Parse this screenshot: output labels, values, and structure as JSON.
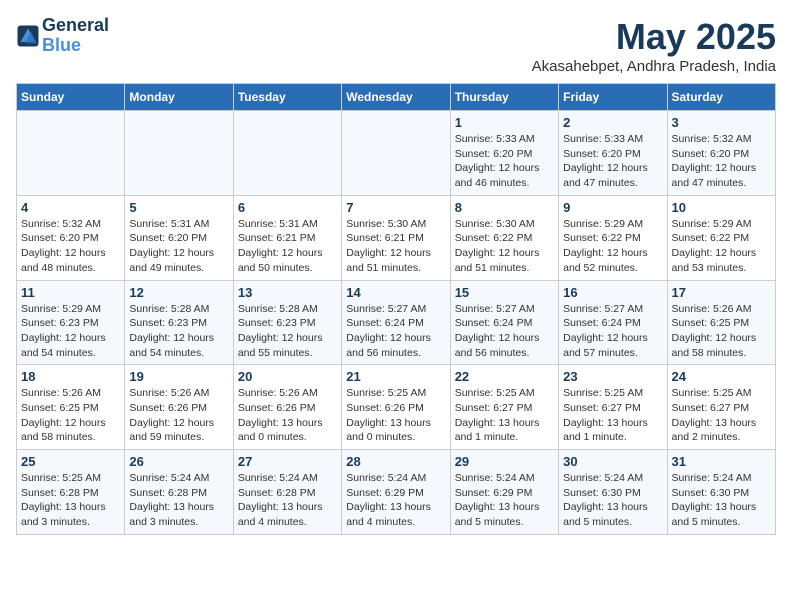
{
  "logo": {
    "line1": "General",
    "line2": "Blue"
  },
  "title": "May 2025",
  "location": "Akasahebpet, Andhra Pradesh, India",
  "days_of_week": [
    "Sunday",
    "Monday",
    "Tuesday",
    "Wednesday",
    "Thursday",
    "Friday",
    "Saturday"
  ],
  "weeks": [
    [
      {
        "day": "",
        "info": ""
      },
      {
        "day": "",
        "info": ""
      },
      {
        "day": "",
        "info": ""
      },
      {
        "day": "",
        "info": ""
      },
      {
        "day": "1",
        "info": "Sunrise: 5:33 AM\nSunset: 6:20 PM\nDaylight: 12 hours\nand 46 minutes."
      },
      {
        "day": "2",
        "info": "Sunrise: 5:33 AM\nSunset: 6:20 PM\nDaylight: 12 hours\nand 47 minutes."
      },
      {
        "day": "3",
        "info": "Sunrise: 5:32 AM\nSunset: 6:20 PM\nDaylight: 12 hours\nand 47 minutes."
      }
    ],
    [
      {
        "day": "4",
        "info": "Sunrise: 5:32 AM\nSunset: 6:20 PM\nDaylight: 12 hours\nand 48 minutes."
      },
      {
        "day": "5",
        "info": "Sunrise: 5:31 AM\nSunset: 6:20 PM\nDaylight: 12 hours\nand 49 minutes."
      },
      {
        "day": "6",
        "info": "Sunrise: 5:31 AM\nSunset: 6:21 PM\nDaylight: 12 hours\nand 50 minutes."
      },
      {
        "day": "7",
        "info": "Sunrise: 5:30 AM\nSunset: 6:21 PM\nDaylight: 12 hours\nand 51 minutes."
      },
      {
        "day": "8",
        "info": "Sunrise: 5:30 AM\nSunset: 6:22 PM\nDaylight: 12 hours\nand 51 minutes."
      },
      {
        "day": "9",
        "info": "Sunrise: 5:29 AM\nSunset: 6:22 PM\nDaylight: 12 hours\nand 52 minutes."
      },
      {
        "day": "10",
        "info": "Sunrise: 5:29 AM\nSunset: 6:22 PM\nDaylight: 12 hours\nand 53 minutes."
      }
    ],
    [
      {
        "day": "11",
        "info": "Sunrise: 5:29 AM\nSunset: 6:23 PM\nDaylight: 12 hours\nand 54 minutes."
      },
      {
        "day": "12",
        "info": "Sunrise: 5:28 AM\nSunset: 6:23 PM\nDaylight: 12 hours\nand 54 minutes."
      },
      {
        "day": "13",
        "info": "Sunrise: 5:28 AM\nSunset: 6:23 PM\nDaylight: 12 hours\nand 55 minutes."
      },
      {
        "day": "14",
        "info": "Sunrise: 5:27 AM\nSunset: 6:24 PM\nDaylight: 12 hours\nand 56 minutes."
      },
      {
        "day": "15",
        "info": "Sunrise: 5:27 AM\nSunset: 6:24 PM\nDaylight: 12 hours\nand 56 minutes."
      },
      {
        "day": "16",
        "info": "Sunrise: 5:27 AM\nSunset: 6:24 PM\nDaylight: 12 hours\nand 57 minutes."
      },
      {
        "day": "17",
        "info": "Sunrise: 5:26 AM\nSunset: 6:25 PM\nDaylight: 12 hours\nand 58 minutes."
      }
    ],
    [
      {
        "day": "18",
        "info": "Sunrise: 5:26 AM\nSunset: 6:25 PM\nDaylight: 12 hours\nand 58 minutes."
      },
      {
        "day": "19",
        "info": "Sunrise: 5:26 AM\nSunset: 6:26 PM\nDaylight: 12 hours\nand 59 minutes."
      },
      {
        "day": "20",
        "info": "Sunrise: 5:26 AM\nSunset: 6:26 PM\nDaylight: 13 hours\nand 0 minutes."
      },
      {
        "day": "21",
        "info": "Sunrise: 5:25 AM\nSunset: 6:26 PM\nDaylight: 13 hours\nand 0 minutes."
      },
      {
        "day": "22",
        "info": "Sunrise: 5:25 AM\nSunset: 6:27 PM\nDaylight: 13 hours\nand 1 minute."
      },
      {
        "day": "23",
        "info": "Sunrise: 5:25 AM\nSunset: 6:27 PM\nDaylight: 13 hours\nand 1 minute."
      },
      {
        "day": "24",
        "info": "Sunrise: 5:25 AM\nSunset: 6:27 PM\nDaylight: 13 hours\nand 2 minutes."
      }
    ],
    [
      {
        "day": "25",
        "info": "Sunrise: 5:25 AM\nSunset: 6:28 PM\nDaylight: 13 hours\nand 3 minutes."
      },
      {
        "day": "26",
        "info": "Sunrise: 5:24 AM\nSunset: 6:28 PM\nDaylight: 13 hours\nand 3 minutes."
      },
      {
        "day": "27",
        "info": "Sunrise: 5:24 AM\nSunset: 6:28 PM\nDaylight: 13 hours\nand 4 minutes."
      },
      {
        "day": "28",
        "info": "Sunrise: 5:24 AM\nSunset: 6:29 PM\nDaylight: 13 hours\nand 4 minutes."
      },
      {
        "day": "29",
        "info": "Sunrise: 5:24 AM\nSunset: 6:29 PM\nDaylight: 13 hours\nand 5 minutes."
      },
      {
        "day": "30",
        "info": "Sunrise: 5:24 AM\nSunset: 6:30 PM\nDaylight: 13 hours\nand 5 minutes."
      },
      {
        "day": "31",
        "info": "Sunrise: 5:24 AM\nSunset: 6:30 PM\nDaylight: 13 hours\nand 5 minutes."
      }
    ]
  ]
}
